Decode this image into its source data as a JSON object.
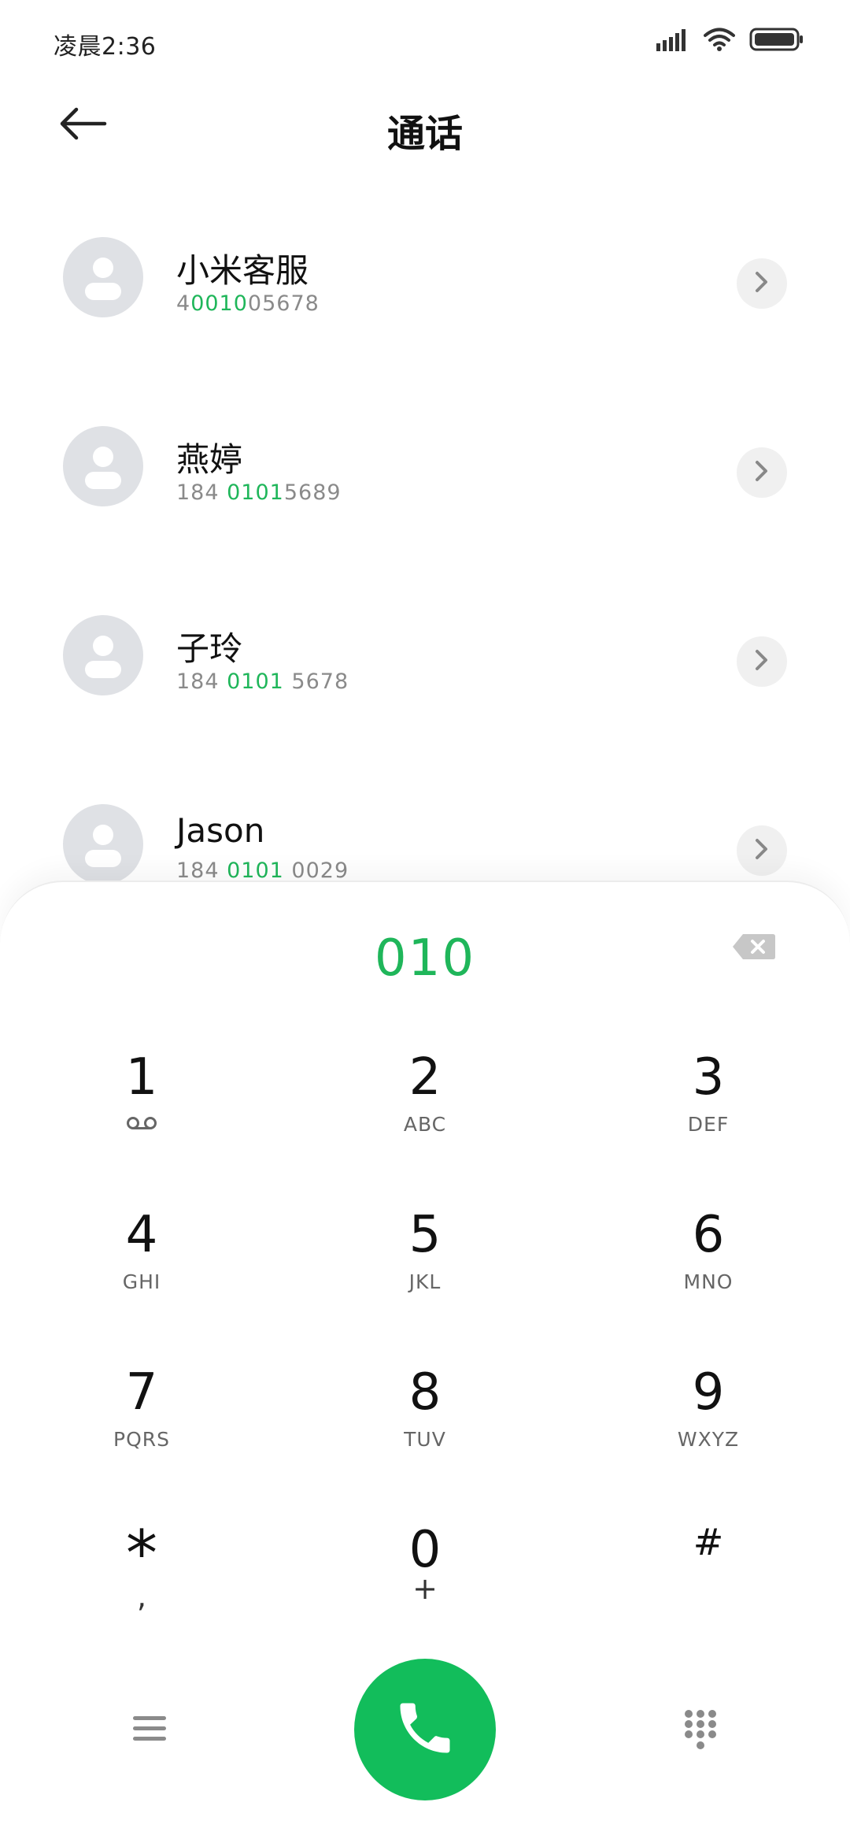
{
  "status_bar": {
    "time": "凌晨2:36",
    "icons": [
      "signal-icon",
      "wifi-icon",
      "battery-icon"
    ]
  },
  "header": {
    "title": "通话",
    "back_icon": "back-arrow-icon"
  },
  "contacts": [
    {
      "name": "小米客服",
      "number_parts": [
        {
          "text": "4",
          "hl": false
        },
        {
          "text": "0010",
          "hl": true
        },
        {
          "text": "05678",
          "hl": false
        }
      ]
    },
    {
      "name": "燕婷",
      "number_parts": [
        {
          "text": "184 ",
          "hl": false
        },
        {
          "text": "0101",
          "hl": true
        },
        {
          "text": "5689",
          "hl": false
        }
      ]
    },
    {
      "name": "子玲",
      "number_parts": [
        {
          "text": "184 ",
          "hl": false
        },
        {
          "text": "0101",
          "hl": true
        },
        {
          "text": " 5678",
          "hl": false
        }
      ]
    },
    {
      "name": "Jason",
      "number_parts": [
        {
          "text": "184 ",
          "hl": false
        },
        {
          "text": "0101",
          "hl": true
        },
        {
          "text": " 0029",
          "hl": false
        }
      ]
    }
  ],
  "dialer": {
    "dialed": "010",
    "keys": [
      {
        "digit": "1",
        "sub": "voicemail-icon"
      },
      {
        "digit": "2",
        "sub": "ABC"
      },
      {
        "digit": "3",
        "sub": "DEF"
      },
      {
        "digit": "4",
        "sub": "GHI"
      },
      {
        "digit": "5",
        "sub": "JKL"
      },
      {
        "digit": "6",
        "sub": "MNO"
      },
      {
        "digit": "7",
        "sub": "PQRS"
      },
      {
        "digit": "8",
        "sub": "TUV"
      },
      {
        "digit": "9",
        "sub": "WXYZ"
      },
      {
        "digit": "*",
        "sub": ","
      },
      {
        "digit": "0",
        "sub": "+"
      },
      {
        "digit": "#",
        "sub": ""
      }
    ]
  },
  "bottom_bar": {
    "icons": [
      "menu-icon",
      "phone-icon",
      "keypad-icon"
    ]
  },
  "colors": {
    "accent": "#1fb65a",
    "call_button": "#12bd5b",
    "avatar_bg": "#dfe1e5"
  }
}
